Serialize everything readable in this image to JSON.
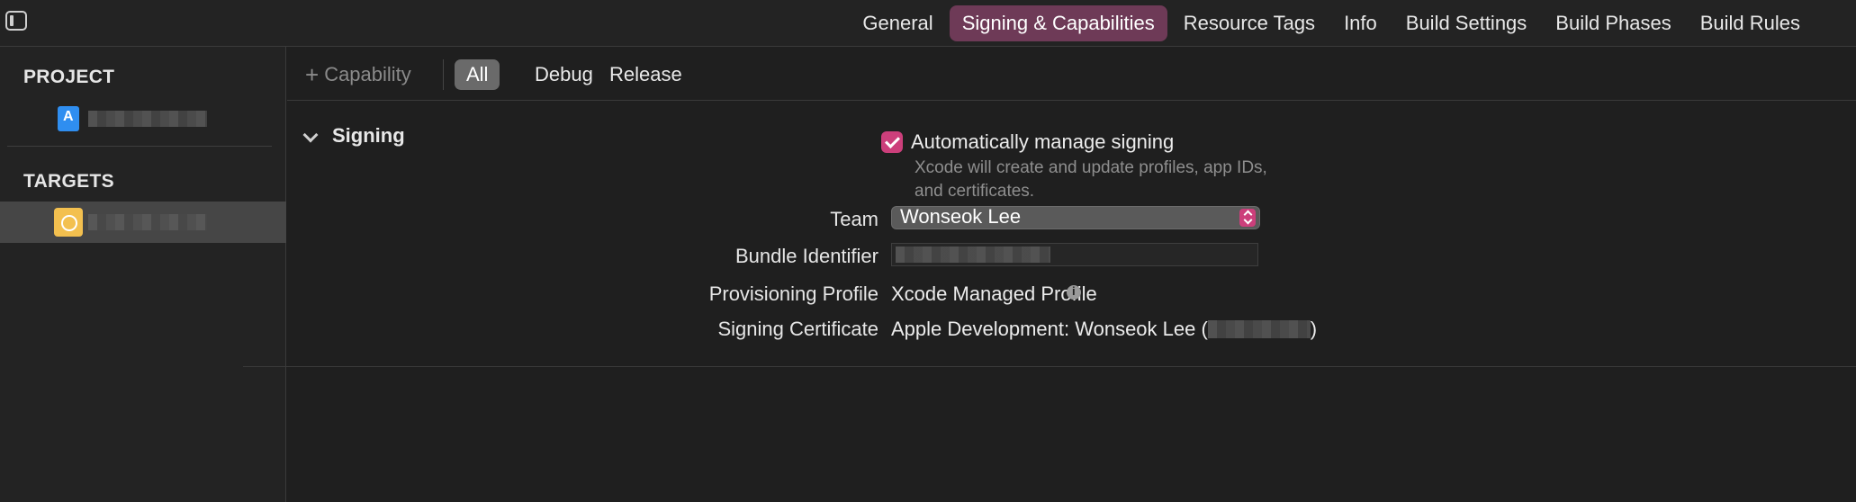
{
  "tabs": [
    "General",
    "Signing & Capabilities",
    "Resource Tags",
    "Info",
    "Build Settings",
    "Build Phases",
    "Build Rules"
  ],
  "sidebar": {
    "project_heading": "PROJECT",
    "targets_heading": "TARGETS"
  },
  "toolbar": {
    "add_capability": "Capability",
    "configs": [
      "All",
      "Debug",
      "Release"
    ]
  },
  "signing": {
    "section_title": "Signing",
    "auto_manage_label": "Automatically manage signing",
    "auto_manage_help": "Xcode will create and update profiles, app IDs, and certificates.",
    "team_label": "Team",
    "team_value": "Wonseok Lee",
    "bundle_label": "Bundle Identifier",
    "profile_label": "Provisioning Profile",
    "profile_value": "Xcode Managed Profile",
    "certificate_label": "Signing Certificate",
    "certificate_value_prefix": "Apple Development: Wonseok Lee (",
    "certificate_value_suffix": ")"
  },
  "colors": {
    "accent": "#cc3f7b",
    "active_tab": "#6e3a57"
  },
  "icons": [
    "sidebar-toggle-icon",
    "xcode-project-icon",
    "app-target-icon",
    "plus-icon",
    "chevron-down-icon",
    "checkbox-checked-icon",
    "stepper-icon",
    "info-icon"
  ]
}
